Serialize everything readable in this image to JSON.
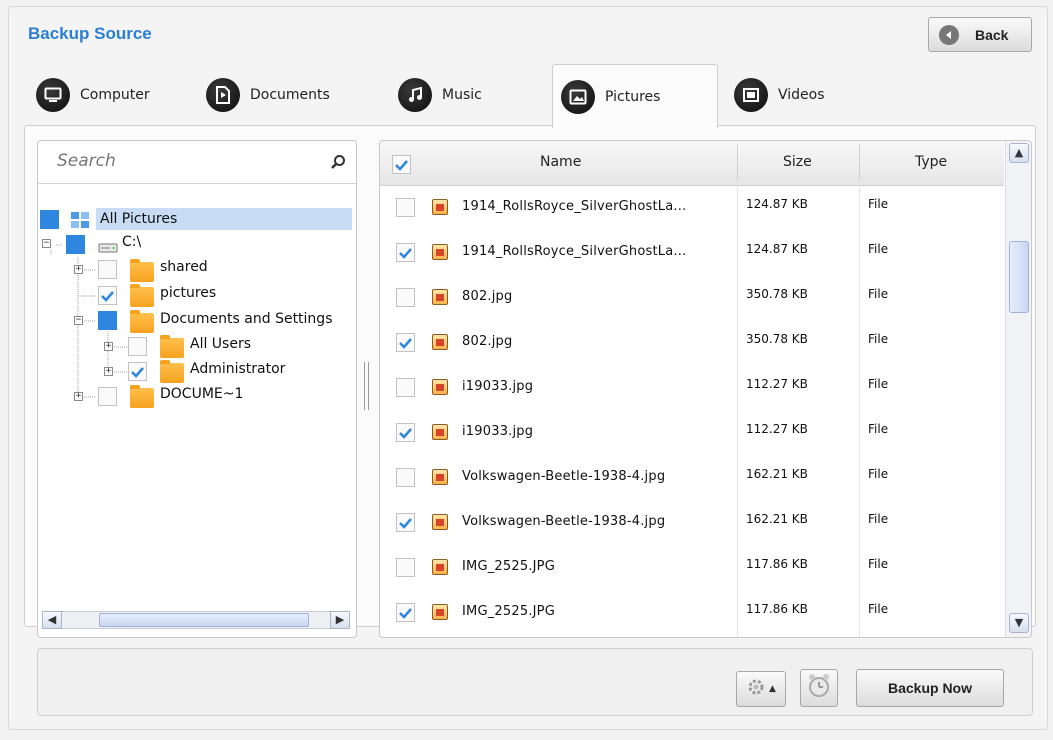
{
  "header": {
    "title": "Backup Source",
    "back_label": "Back"
  },
  "tabs": [
    {
      "label": "Computer",
      "icon": "monitor-icon",
      "active": false
    },
    {
      "label": "Documents",
      "icon": "document-icon",
      "active": false
    },
    {
      "label": "Music",
      "icon": "music-note-icon",
      "active": false
    },
    {
      "label": "Pictures",
      "icon": "picture-icon",
      "active": true
    },
    {
      "label": "Videos",
      "icon": "film-icon",
      "active": false
    }
  ],
  "search": {
    "placeholder": "Search"
  },
  "tree": [
    {
      "label": "All Pictures",
      "state": "full",
      "kind": "all"
    },
    {
      "label": "C:\\",
      "state": "full",
      "kind": "drive",
      "expander": "-"
    },
    {
      "label": "shared",
      "state": "empty",
      "kind": "folder",
      "expander": "+"
    },
    {
      "label": "pictures",
      "state": "checked",
      "kind": "folder"
    },
    {
      "label": "Documents and Settings",
      "state": "full",
      "kind": "folder",
      "expander": "-"
    },
    {
      "label": "All Users",
      "state": "empty",
      "kind": "folder",
      "expander": "+"
    },
    {
      "label": "Administrator",
      "state": "checked",
      "kind": "folder",
      "expander": "+"
    },
    {
      "label": "DOCUME~1",
      "state": "empty",
      "kind": "folder",
      "expander": "+"
    }
  ],
  "table": {
    "columns": {
      "name": "Name",
      "size": "Size",
      "type": "Type"
    },
    "rows": [
      {
        "checked": false,
        "name": "1914_RollsRoyce_SilverGhostLa...",
        "size": "124.87 KB",
        "type": "File"
      },
      {
        "checked": true,
        "name": "1914_RollsRoyce_SilverGhostLa...",
        "size": "124.87 KB",
        "type": "File"
      },
      {
        "checked": false,
        "name": "802.jpg",
        "size": "350.78 KB",
        "type": "File"
      },
      {
        "checked": true,
        "name": "802.jpg",
        "size": "350.78 KB",
        "type": "File"
      },
      {
        "checked": false,
        "name": "i19033.jpg",
        "size": "112.27 KB",
        "type": "File"
      },
      {
        "checked": true,
        "name": "i19033.jpg",
        "size": "112.27 KB",
        "type": "File"
      },
      {
        "checked": false,
        "name": "Volkswagen-Beetle-1938-4.jpg",
        "size": "162.21 KB",
        "type": "File"
      },
      {
        "checked": true,
        "name": "Volkswagen-Beetle-1938-4.jpg",
        "size": "162.21 KB",
        "type": "File"
      },
      {
        "checked": false,
        "name": "IMG_2525.JPG",
        "size": "117.86 KB",
        "type": "File"
      },
      {
        "checked": true,
        "name": "IMG_2525.JPG",
        "size": "117.86 KB",
        "type": "File"
      }
    ]
  },
  "footer": {
    "backup_label": "Backup Now"
  },
  "colors": {
    "accent": "#2e86de",
    "title": "#2a7fd4"
  }
}
